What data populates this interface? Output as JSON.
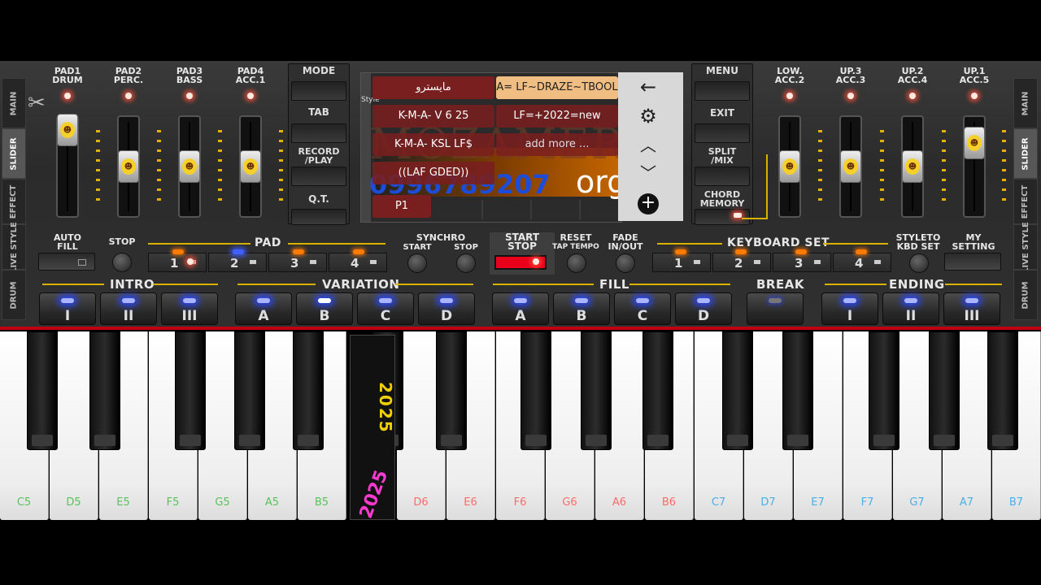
{
  "side_tabs_left": [
    "MAIN",
    "SLIDER",
    "EFFECT",
    "LIVE STYLE",
    "DRUM"
  ],
  "side_tabs_right": [
    "MAIN",
    "SLIDER",
    "EFFECT",
    "LIVE STYLE",
    "DRUM"
  ],
  "pads_left": [
    "PAD1\nDRUM",
    "PAD2\nPERC.",
    "PAD3\nBASS",
    "PAD4\nACC.1"
  ],
  "pads_right": [
    "LOW.\nACC.2",
    "UP.3\nACC.3",
    "UP.2\nACC.4",
    "UP.1\nACC.5"
  ],
  "menu_left": {
    "mode": "MODE",
    "tab": "TAB",
    "record": "RECORD\n/PLAY",
    "qt": "Q.T."
  },
  "menu_right": {
    "menu": "MENU",
    "exit": "EXIT",
    "split": "SPLIT\n/MIX",
    "chord": "CHORD\nMEMORY"
  },
  "screen": {
    "styles": [
      "مايسترو",
      "A= LF~DRAZE~TBOOL",
      "K-M-A- V 6 25",
      "LF=+2022=new",
      "K-M-A- KSL LF$",
      "add more ...",
      "((LAF GDED))"
    ],
    "page": "P1",
    "side_label": "Style",
    "watermark": "MOZAMER",
    "phone": "0996789207",
    "org": "org",
    "icons": {
      "back": "arrow-left",
      "settings": "gear",
      "up": "chevron-up",
      "down": "chevron-down",
      "add": "plus-circle"
    }
  },
  "row1": {
    "auto_fill": "AUTO\nFILL",
    "stop": "STOP",
    "pad": "PAD",
    "pad_buttons": [
      "1",
      "2",
      "3",
      "4"
    ],
    "synchro": "SYNCHRO",
    "synchro_start": "START",
    "synchro_stop": "STOP",
    "start_stop": "START\nSTOP",
    "reset": "RESET",
    "tap_tempo": "TAP TEMPO",
    "fade": "FADE\nIN/OUT",
    "keyboard_set": "KEYBOARD SET",
    "kbd_buttons": [
      "1",
      "2",
      "3",
      "4"
    ],
    "style_to_kbd": "STYLETO\nKBD SET",
    "my_setting": "MY\nSETTING"
  },
  "sections": {
    "intro": {
      "label": "INTRO",
      "buttons": [
        "I",
        "II",
        "III"
      ]
    },
    "variation": {
      "label": "VARIATION",
      "buttons": [
        "A",
        "B",
        "C",
        "D"
      ]
    },
    "fill": {
      "label": "FILL",
      "buttons": [
        "A",
        "B",
        "C",
        "D"
      ]
    },
    "break": {
      "label": "BREAK"
    },
    "ending": {
      "label": "ENDING",
      "buttons": [
        "I",
        "II",
        "III"
      ]
    }
  },
  "overlay_text": {
    "year": "2025",
    "vertical": "2025"
  },
  "keys": {
    "white": [
      "C5",
      "D5",
      "E5",
      "F5",
      "G5",
      "A5",
      "B5",
      "D6",
      "E6",
      "F6",
      "G6",
      "A6",
      "B6",
      "C7",
      "D7",
      "E7",
      "F7",
      "G7",
      "A7",
      "B7"
    ],
    "colors": {
      "octave5": "#58c35a",
      "octave6": "#ff6a6a",
      "octave7": "#49b0e8"
    }
  }
}
